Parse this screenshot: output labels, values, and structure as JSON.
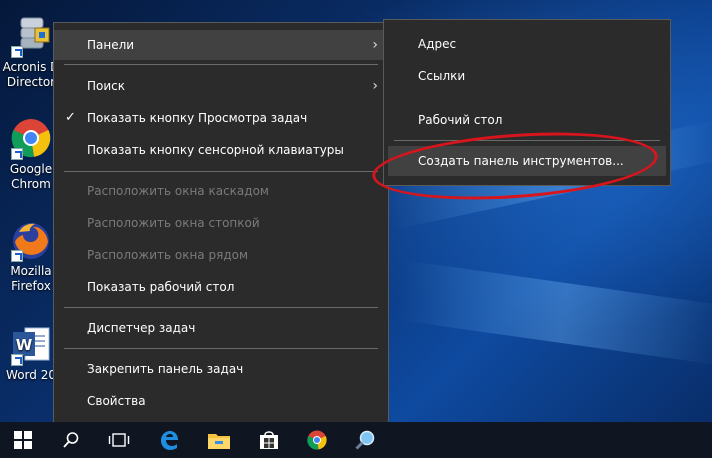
{
  "desktop": {
    "icons": [
      {
        "label": "Acronis D Director",
        "line1": "Acronis D",
        "line2": "Director",
        "icon": "acronis-icon"
      },
      {
        "label": "Google Chrome",
        "line1": "Google",
        "line2": "Chrom",
        "icon": "chrome-icon"
      },
      {
        "label": "Mozilla Firefox",
        "line1": "Mozilla",
        "line2": "Firefox",
        "icon": "firefox-icon"
      },
      {
        "label": "Word 20",
        "line1": "Word 20",
        "line2": "",
        "icon": "word-icon"
      }
    ]
  },
  "context_menu": {
    "items": [
      {
        "label": "Панели",
        "submenu": true,
        "highlighted": true
      },
      {
        "label": "Поиск",
        "submenu": true
      },
      {
        "label": "Показать кнопку Просмотра задач",
        "checked": true
      },
      {
        "label": "Показать кнопку сенсорной клавиатуры"
      },
      {
        "label": "Расположить окна каскадом",
        "disabled": true
      },
      {
        "label": "Расположить окна стопкой",
        "disabled": true
      },
      {
        "label": "Расположить окна рядом",
        "disabled": true
      },
      {
        "label": "Показать рабочий стол"
      },
      {
        "label": "Диспетчер задач"
      },
      {
        "label": "Закрепить панель задач"
      },
      {
        "label": "Свойства"
      }
    ],
    "check_glyph": "✓",
    "submenu_glyph": "›"
  },
  "panels_submenu": {
    "items": [
      {
        "label": "Адрес"
      },
      {
        "label": "Ссылки"
      },
      {
        "label": "Рабочий стол"
      },
      {
        "label": "Создать панель инструментов...",
        "highlighted": true
      }
    ]
  },
  "annotation": {
    "color": "#d8141c",
    "target": "Создать панель инструментов..."
  },
  "taskbar": {
    "buttons": [
      "windows-start-icon",
      "search-icon",
      "task-view-icon",
      "edge-icon",
      "file-explorer-icon",
      "store-icon",
      "chrome-icon",
      "magnifier-icon"
    ]
  },
  "colors": {
    "menu_bg": "#2b2b2b",
    "menu_highlight": "#414141",
    "disabled_text": "#7a7a7a",
    "taskbar_bg": "#101522"
  }
}
